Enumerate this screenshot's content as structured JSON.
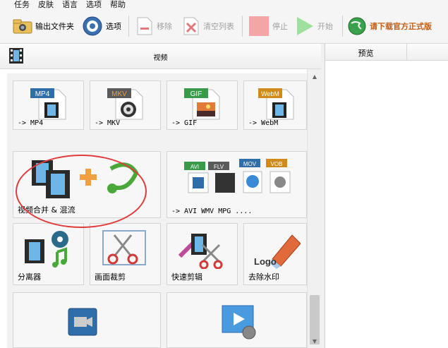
{
  "menu": [
    "任务",
    "皮肤",
    "语言",
    "选项",
    "帮助"
  ],
  "toolbar": {
    "output_folder": "输出文件夹",
    "options": "选项",
    "remove": "移除",
    "clear_list": "清空列表",
    "stop": "停止",
    "start": "开始",
    "download_official": "请下载官方正式版"
  },
  "left_panel": {
    "title": "视频",
    "tiles": [
      {
        "badge": "MP4",
        "label": "-> MP4",
        "badge_color": "#2f6ea8"
      },
      {
        "badge": "MKV",
        "label": "-> MKV",
        "badge_color": "#5a5a5a"
      },
      {
        "badge": "GIF",
        "label": "-> GIF",
        "badge_color": "#3a9a4a"
      },
      {
        "badge": "WebM",
        "label": "-> WebM",
        "badge_color": "#d08a1a"
      },
      {
        "label": "视频合并 & 混流"
      },
      {
        "label": "-> AVI WMV MPG ....",
        "badges": [
          "AVI",
          "FLV",
          "MOV",
          "VOB"
        ]
      },
      {
        "label": "分离器"
      },
      {
        "label": "画面裁剪"
      },
      {
        "label": "快速剪辑"
      },
      {
        "label": "去除水印",
        "logo_text": "Logo"
      },
      {
        "label": ""
      },
      {
        "label": ""
      }
    ]
  },
  "right_panel": {
    "title": "预览"
  },
  "colors": {
    "highlight": "#e03b3b",
    "promo": "#c0601a"
  }
}
